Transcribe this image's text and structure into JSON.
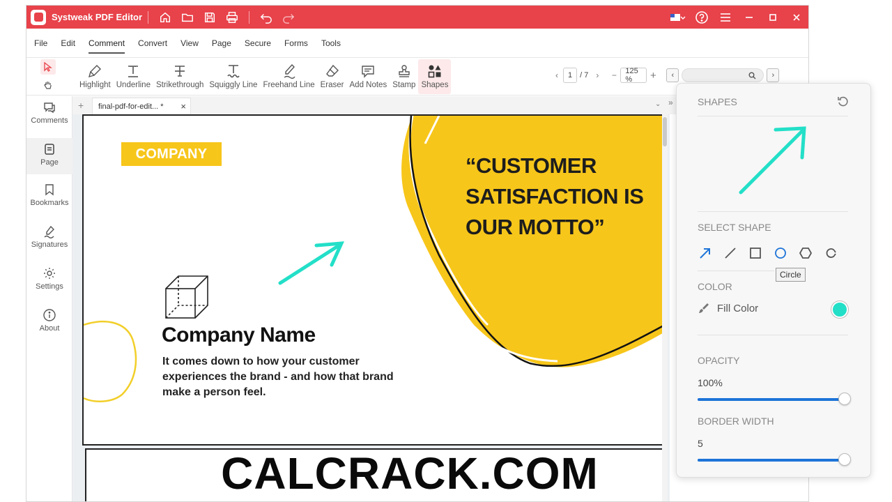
{
  "app": {
    "title": "Systweak PDF Editor"
  },
  "menu": [
    "File",
    "Edit",
    "Comment",
    "Convert",
    "View",
    "Page",
    "Secure",
    "Forms",
    "Tools"
  ],
  "toolbar": {
    "tools": [
      {
        "label": "Highlight",
        "icon": "highlight-icon"
      },
      {
        "label": "Underline",
        "icon": "underline-icon"
      },
      {
        "label": "Strikethrough",
        "icon": "strikethrough-icon"
      },
      {
        "label": "Squiggly Line",
        "icon": "squiggly-line-icon"
      },
      {
        "label": "Freehand Line",
        "icon": "freehand-line-icon"
      },
      {
        "label": "Eraser",
        "icon": "eraser-icon"
      },
      {
        "label": "Add Notes",
        "icon": "add-notes-icon"
      },
      {
        "label": "Stamp",
        "icon": "stamp-icon"
      },
      {
        "label": "Shapes",
        "icon": "shapes-icon"
      }
    ],
    "page_current": "1",
    "page_total": "/ 7",
    "zoom": "125 %"
  },
  "sidebar": [
    {
      "label": "Comments",
      "icon": "comments-icon"
    },
    {
      "label": "Page",
      "icon": "page-icon"
    },
    {
      "label": "Bookmarks",
      "icon": "bookmark-icon"
    },
    {
      "label": "Signatures",
      "icon": "signature-icon"
    },
    {
      "label": "Settings",
      "icon": "settings-icon"
    },
    {
      "label": "About",
      "icon": "about-icon"
    }
  ],
  "tab": {
    "label": "final-pdf-for-edit... *",
    "close": "×",
    "add": "+"
  },
  "document": {
    "company_tag": "COMPANY",
    "quote_lines": [
      "“CUSTOMER",
      "SATISFACTION IS",
      "OUR MOTTO”"
    ],
    "company_name": "Company Name",
    "description_lines": [
      "It comes down to how your customer",
      "experiences the brand - and how that brand",
      "make a person feel."
    ]
  },
  "shapes_panel": {
    "title": "SHAPES",
    "select_shape_label": "SELECT SHAPE",
    "tooltip": "Circle",
    "color_label": "COLOR",
    "fill_color_label": "Fill Color",
    "fill_color": "#23dfc8",
    "opacity_label": "OPACITY",
    "opacity_value": "100%",
    "opacity_fraction": 1.0,
    "border_width_label": "BORDER WIDTH",
    "border_width_value": "5",
    "border_width_fraction": 1.0,
    "shapes": [
      "arrow-icon",
      "line-icon",
      "rectangle-icon",
      "circle-icon",
      "hexagon-icon",
      "arc-icon"
    ]
  },
  "colors": {
    "brand_red": "#e8424a",
    "accent_yellow": "#f7c61a",
    "arrow_teal": "#23dfc8",
    "slider_blue": "#1d74d8"
  },
  "watermark": "CALCRACK.COM"
}
